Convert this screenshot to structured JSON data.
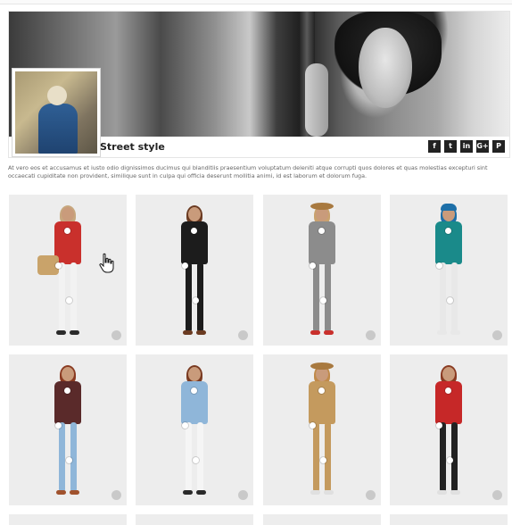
{
  "header": {
    "title": "Street style",
    "social": [
      {
        "icon": "facebook-icon",
        "glyph": "f"
      },
      {
        "icon": "twitter-icon",
        "glyph": "t"
      },
      {
        "icon": "linkedin-icon",
        "glyph": "in"
      },
      {
        "icon": "google-plus-icon",
        "glyph": "G+"
      },
      {
        "icon": "pinterest-icon",
        "glyph": "P"
      }
    ]
  },
  "description": "At vero eos et accusamus et iusto odio dignissimos ducimus qui blanditiis praesentium voluptatum deleniti atque corrupti quos dolores et quas molestias excepturi sint occaecati cupiditate non provident, similique sunt in culpa qui officia deserunt mollitia animi, id est laborum et dolorum fuga.",
  "products": [
    {
      "name": "look-1",
      "hair": "#c7a77e",
      "top": "#c9302c",
      "bottom": "#f2f2f2",
      "shoes": "#2a2a2a",
      "accessory": "basket-bag"
    },
    {
      "name": "look-2",
      "hair": "#6b3b22",
      "top": "#1c1c1c",
      "bottom": "#1c1c1c",
      "shoes": "#6b3b22",
      "accessory": "none"
    },
    {
      "name": "look-3",
      "hair": "#c9a26e",
      "top": "#8c8c8c",
      "bottom": "#8c8c8c",
      "shoes": "#c9302c",
      "accessory": "hat"
    },
    {
      "name": "look-4",
      "hair": "#1d6fa8",
      "top": "#1a8a8a",
      "bottom": "#e8e8e8",
      "shoes": "#e8e8e8",
      "accessory": "cap"
    },
    {
      "name": "look-5",
      "hair": "#8a3b22",
      "top": "#5a2a2a",
      "bottom": "#8fb6d9",
      "shoes": "#a0522d",
      "accessory": "none"
    },
    {
      "name": "look-6",
      "hair": "#7a3b22",
      "top": "#8fb6d9",
      "bottom": "#f5f5f5",
      "shoes": "#2a2a2a",
      "accessory": "none"
    },
    {
      "name": "look-7",
      "hair": "#c08a4a",
      "top": "#c49a5e",
      "bottom": "#c49a5e",
      "shoes": "#e0e0e0",
      "accessory": "hat"
    },
    {
      "name": "look-8",
      "hair": "#8a3b22",
      "top": "#c62828",
      "bottom": "#222222",
      "shoes": "#e0e0e0",
      "accessory": "none"
    }
  ],
  "cart_glyph": "🛒"
}
